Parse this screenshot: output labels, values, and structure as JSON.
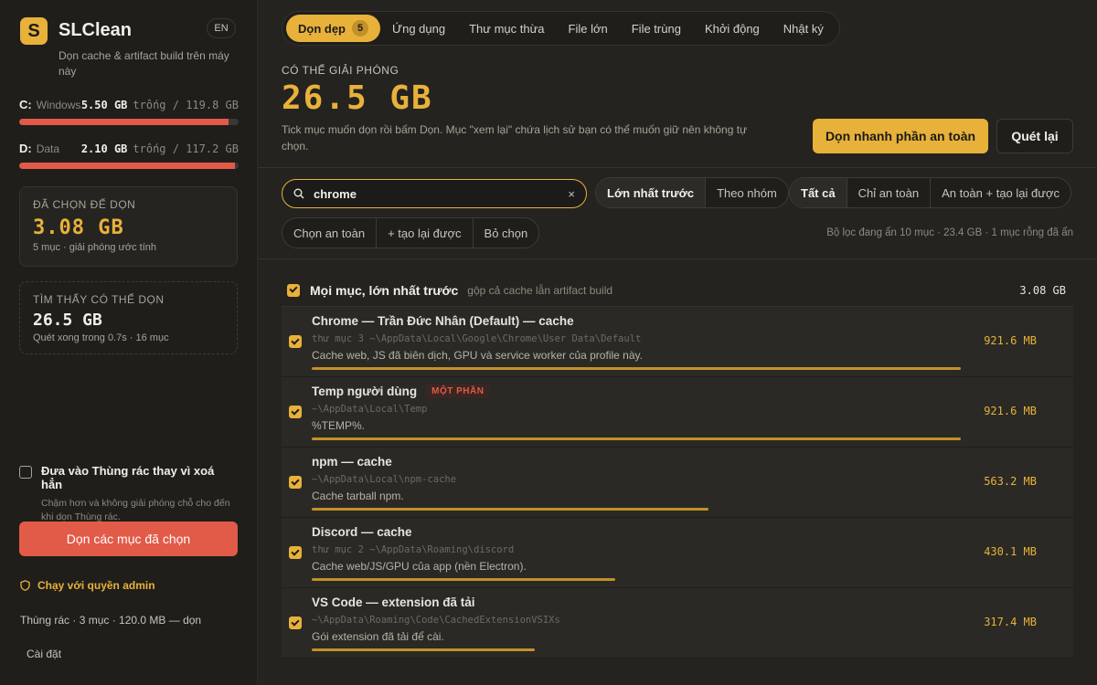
{
  "app": {
    "logo_letter": "S",
    "name": "SLClean",
    "lang": "EN",
    "tagline": "Dọn cache & artifact build trên máy này"
  },
  "drives": [
    {
      "letter": "C:",
      "name": "Windows",
      "free": "5.50 GB",
      "total": "trống / 119.8 GB",
      "used_fraction": 0.954
    },
    {
      "letter": "D:",
      "name": "Data",
      "free": "2.10 GB",
      "total": "trống / 117.2 GB",
      "used_fraction": 0.982
    }
  ],
  "selected_card": {
    "label": "ĐÃ CHỌN ĐỂ DỌN",
    "value": "3.08 GB",
    "sub": "5 mục · giải phóng ước tính"
  },
  "found_card": {
    "label": "TÌM THẤY CÓ THỂ DỌN",
    "value": "26.5 GB",
    "sub": "Quét xong trong 0.7s · 16 mục"
  },
  "trash_option": {
    "title": "Đưa vào Thùng rác thay vì xoá hẳn",
    "desc": "Chậm hơn và không giải phóng chỗ cho đến khi dọn Thùng rác."
  },
  "clean_button": "Dọn các mục đã chọn",
  "admin_link": "Chạy với quyền admin",
  "trash_status": "Thùng rác · 3 mục · 120.0 MB — dọn",
  "settings": "Cài đặt",
  "nav": {
    "tabs": [
      {
        "label": "Dọn dẹp",
        "badge": "5",
        "active": true
      },
      {
        "label": "Ứng dụng"
      },
      {
        "label": "Thư mục thừa"
      },
      {
        "label": "File lớn"
      },
      {
        "label": "File trùng"
      },
      {
        "label": "Khởi động"
      },
      {
        "label": "Nhật ký"
      }
    ]
  },
  "hero": {
    "label": "CÓ THỂ GIẢI PHÓNG",
    "value": "26.5 GB",
    "desc": "Tick mục muốn dọn rồi bấm Dọn. Mục \"xem lại\" chứa lịch sử bạn có thể muốn giữ nên không tự chọn.",
    "safe_button": "Dọn nhanh phần an toàn",
    "rescan_button": "Quét lại"
  },
  "search": {
    "value": "chrome",
    "clear": "×"
  },
  "sort_toggle": [
    "Lớn nhất trước",
    "Theo nhóm"
  ],
  "filter_toggle": [
    "Tất cả",
    "Chỉ an toàn",
    "An toàn + tạo lại được"
  ],
  "select_toggle": [
    "Chọn an toàn",
    "+ tạo lại được",
    "Bỏ chọn"
  ],
  "filter_note": "Bộ lọc đang ẩn 10 mục · 23.4 GB · 1 mục rỗng đã ẩn",
  "list": {
    "header": {
      "title": "Mọi mục, lớn nhất trước",
      "sub": "gộp cả cache lẫn artifact build",
      "size": "3.08 GB"
    },
    "rows": [
      {
        "title": "Chrome — Trần Đức Nhân (Default) — cache",
        "badge": "",
        "path": " thư mục 3 ~\\AppData\\Local\\Google\\Chrome\\User Data\\Default",
        "desc": "Cache web, JS đã biên dịch, GPU và service worker của profile này.",
        "size": "921.6 MB",
        "bar_fraction": 1.0
      },
      {
        "title": "Temp người dùng",
        "badge": "MỘT PHẦN",
        "path": "~\\AppData\\Local\\Temp",
        "desc": "%TEMP%.",
        "size": "921.6 MB",
        "bar_fraction": 1.0
      },
      {
        "title": "npm — cache",
        "badge": "",
        "path": "~\\AppData\\Local\\npm-cache",
        "desc": "Cache tarball npm.",
        "size": "563.2 MB",
        "bar_fraction": 0.611
      },
      {
        "title": "Discord — cache",
        "badge": "",
        "path": " thư mục 2 ~\\AppData\\Roaming\\discord",
        "desc": "Cache web/JS/GPU của app (nền Electron).",
        "size": "430.1 MB",
        "bar_fraction": 0.467
      },
      {
        "title": "VS Code — extension đã tải",
        "badge": "",
        "path": "~\\AppData\\Roaming\\Code\\CachedExtensionVSIXs",
        "desc": "Gói extension đã tải để cài.",
        "size": "317.4 MB",
        "bar_fraction": 0.344
      }
    ]
  },
  "colors": {
    "accent": "#e8b13a",
    "danger": "#e25a48",
    "bg": "#1c1b19"
  }
}
